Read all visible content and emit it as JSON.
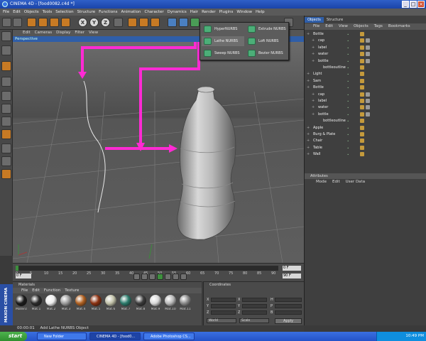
{
  "window": {
    "title": "CINEMA 4D - [food0082.c4d *]"
  },
  "menubar": [
    "File",
    "Edit",
    "Objects",
    "Tools",
    "Selection",
    "Structure",
    "Functions",
    "Animation",
    "Character",
    "Dynamics",
    "Hair",
    "Render",
    "Plugins",
    "Window",
    "Help"
  ],
  "toolbar": {
    "axis_buttons": [
      "X",
      "Y",
      "Z"
    ]
  },
  "viewport": {
    "menu": [
      "Edit",
      "Cameras",
      "Display",
      "Filter",
      "View"
    ],
    "label": "Perspective"
  },
  "nurbs_menu": {
    "items": [
      {
        "label": "HyperNURBS"
      },
      {
        "label": "Extrude NURBS"
      },
      {
        "label": "Lathe NURBS",
        "selected": true
      },
      {
        "label": "Loft NURBS"
      },
      {
        "label": "Sweep NURBS"
      },
      {
        "label": "Bezier NURBS"
      }
    ]
  },
  "timeline": {
    "ticks": [
      "0",
      "5",
      "10",
      "15",
      "20",
      "25",
      "30",
      "35",
      "40",
      "45",
      "50",
      "55",
      "60",
      "65",
      "70",
      "75",
      "80",
      "85",
      "90"
    ],
    "current_frame": "0 F",
    "end_frame": "90 F",
    "start_field": "0 F"
  },
  "materials": {
    "header": "Materials",
    "menu": [
      "File",
      "Edit",
      "Function",
      "Texture"
    ],
    "items": [
      {
        "name": "Material",
        "color": "#1a1a1a"
      },
      {
        "name": "Mat.1",
        "color": "#2a2a2a"
      },
      {
        "name": "Mat.2",
        "color": "#eeeeee"
      },
      {
        "name": "Mat.3",
        "color": "#9c9c9c"
      },
      {
        "name": "Mat.4",
        "color": "#b06020"
      },
      {
        "name": "Mat.5",
        "color": "#8a3010"
      },
      {
        "name": "Mat.6",
        "color": "#c0c0a8"
      },
      {
        "name": "Mat.7",
        "color": "#2a7a6a"
      },
      {
        "name": "Mat.8",
        "color": "#3a3a3a"
      },
      {
        "name": "Mat.9",
        "color": "#d8d8d8"
      },
      {
        "name": "Mat.10",
        "color": "#b8b8b8"
      },
      {
        "name": "Mat.11",
        "color": "#888888"
      }
    ]
  },
  "coordinates": {
    "header": "Coordinates",
    "rows": [
      "X",
      "Y",
      "Z"
    ],
    "rot_labels": [
      "H",
      "P",
      "B"
    ],
    "mode": "World",
    "scale": "Scale",
    "apply": "Apply"
  },
  "status": {
    "text": "Add Lathe NURBS Object",
    "time": "00:00:01"
  },
  "object_manager": {
    "tabs": [
      "Objects",
      "Structure"
    ],
    "menu": [
      "File",
      "Edit",
      "View",
      "Objects",
      "Tags",
      "Bookmarks"
    ],
    "rows": [
      {
        "name": "Bottle",
        "indent": 0
      },
      {
        "name": "cap",
        "indent": 1
      },
      {
        "name": "label",
        "indent": 1
      },
      {
        "name": "water",
        "indent": 1
      },
      {
        "name": "bottle",
        "indent": 1
      },
      {
        "name": "bottleoutline",
        "indent": 2
      },
      {
        "name": "Light",
        "indent": 0
      },
      {
        "name": "Sam",
        "indent": 0
      },
      {
        "name": "Bottle",
        "indent": 0
      },
      {
        "name": "cap",
        "indent": 1
      },
      {
        "name": "label",
        "indent": 1
      },
      {
        "name": "water",
        "indent": 1
      },
      {
        "name": "bottle",
        "indent": 1
      },
      {
        "name": "bottleoutline",
        "indent": 2
      },
      {
        "name": "Apple",
        "indent": 0
      },
      {
        "name": "Burg & Plate",
        "indent": 0
      },
      {
        "name": "Chair",
        "indent": 0
      },
      {
        "name": "Table",
        "indent": 0
      },
      {
        "name": "Wall",
        "indent": 0
      }
    ]
  },
  "attributes": {
    "header": "Attributes",
    "menu": [
      "Mode",
      "Edit",
      "User Data"
    ]
  },
  "taskbar": {
    "start": "start",
    "tasks": [
      "New Folder",
      "CINEMA 4D - [food0...",
      "Adobe Photoshop CS..."
    ],
    "clock": "10:49 PM"
  },
  "logo": "MAXON CINEMA 4D",
  "colors": {
    "annotation": "#ff2ad4",
    "accent": "#2f5ea8"
  }
}
